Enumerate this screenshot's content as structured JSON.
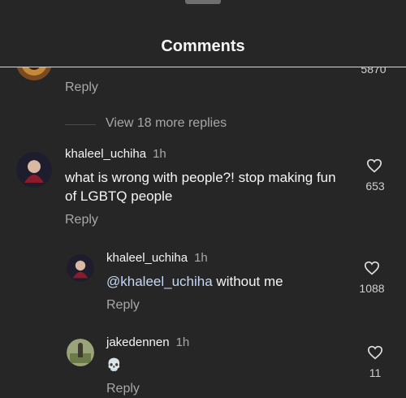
{
  "header": {
    "title": "Comments"
  },
  "prev_comment": {
    "like_count": "5870",
    "reply_label": "Reply",
    "view_replies_label": "View 18 more replies"
  },
  "comments": [
    {
      "username": "khaleel_uchiha",
      "time": "1h",
      "text": "what is wrong with people?! stop making fun of LGBTQ people",
      "like_count": "653",
      "reply_label": "Reply"
    },
    {
      "username": "khaleel_uchiha",
      "time": "1h",
      "mention": "@khaleel_uchiha",
      "text": " without me",
      "like_count": "1088",
      "reply_label": "Reply"
    },
    {
      "username": "jakedennen",
      "time": "1h",
      "emoji": "💀",
      "like_count": "11",
      "reply_label": "Reply"
    }
  ]
}
